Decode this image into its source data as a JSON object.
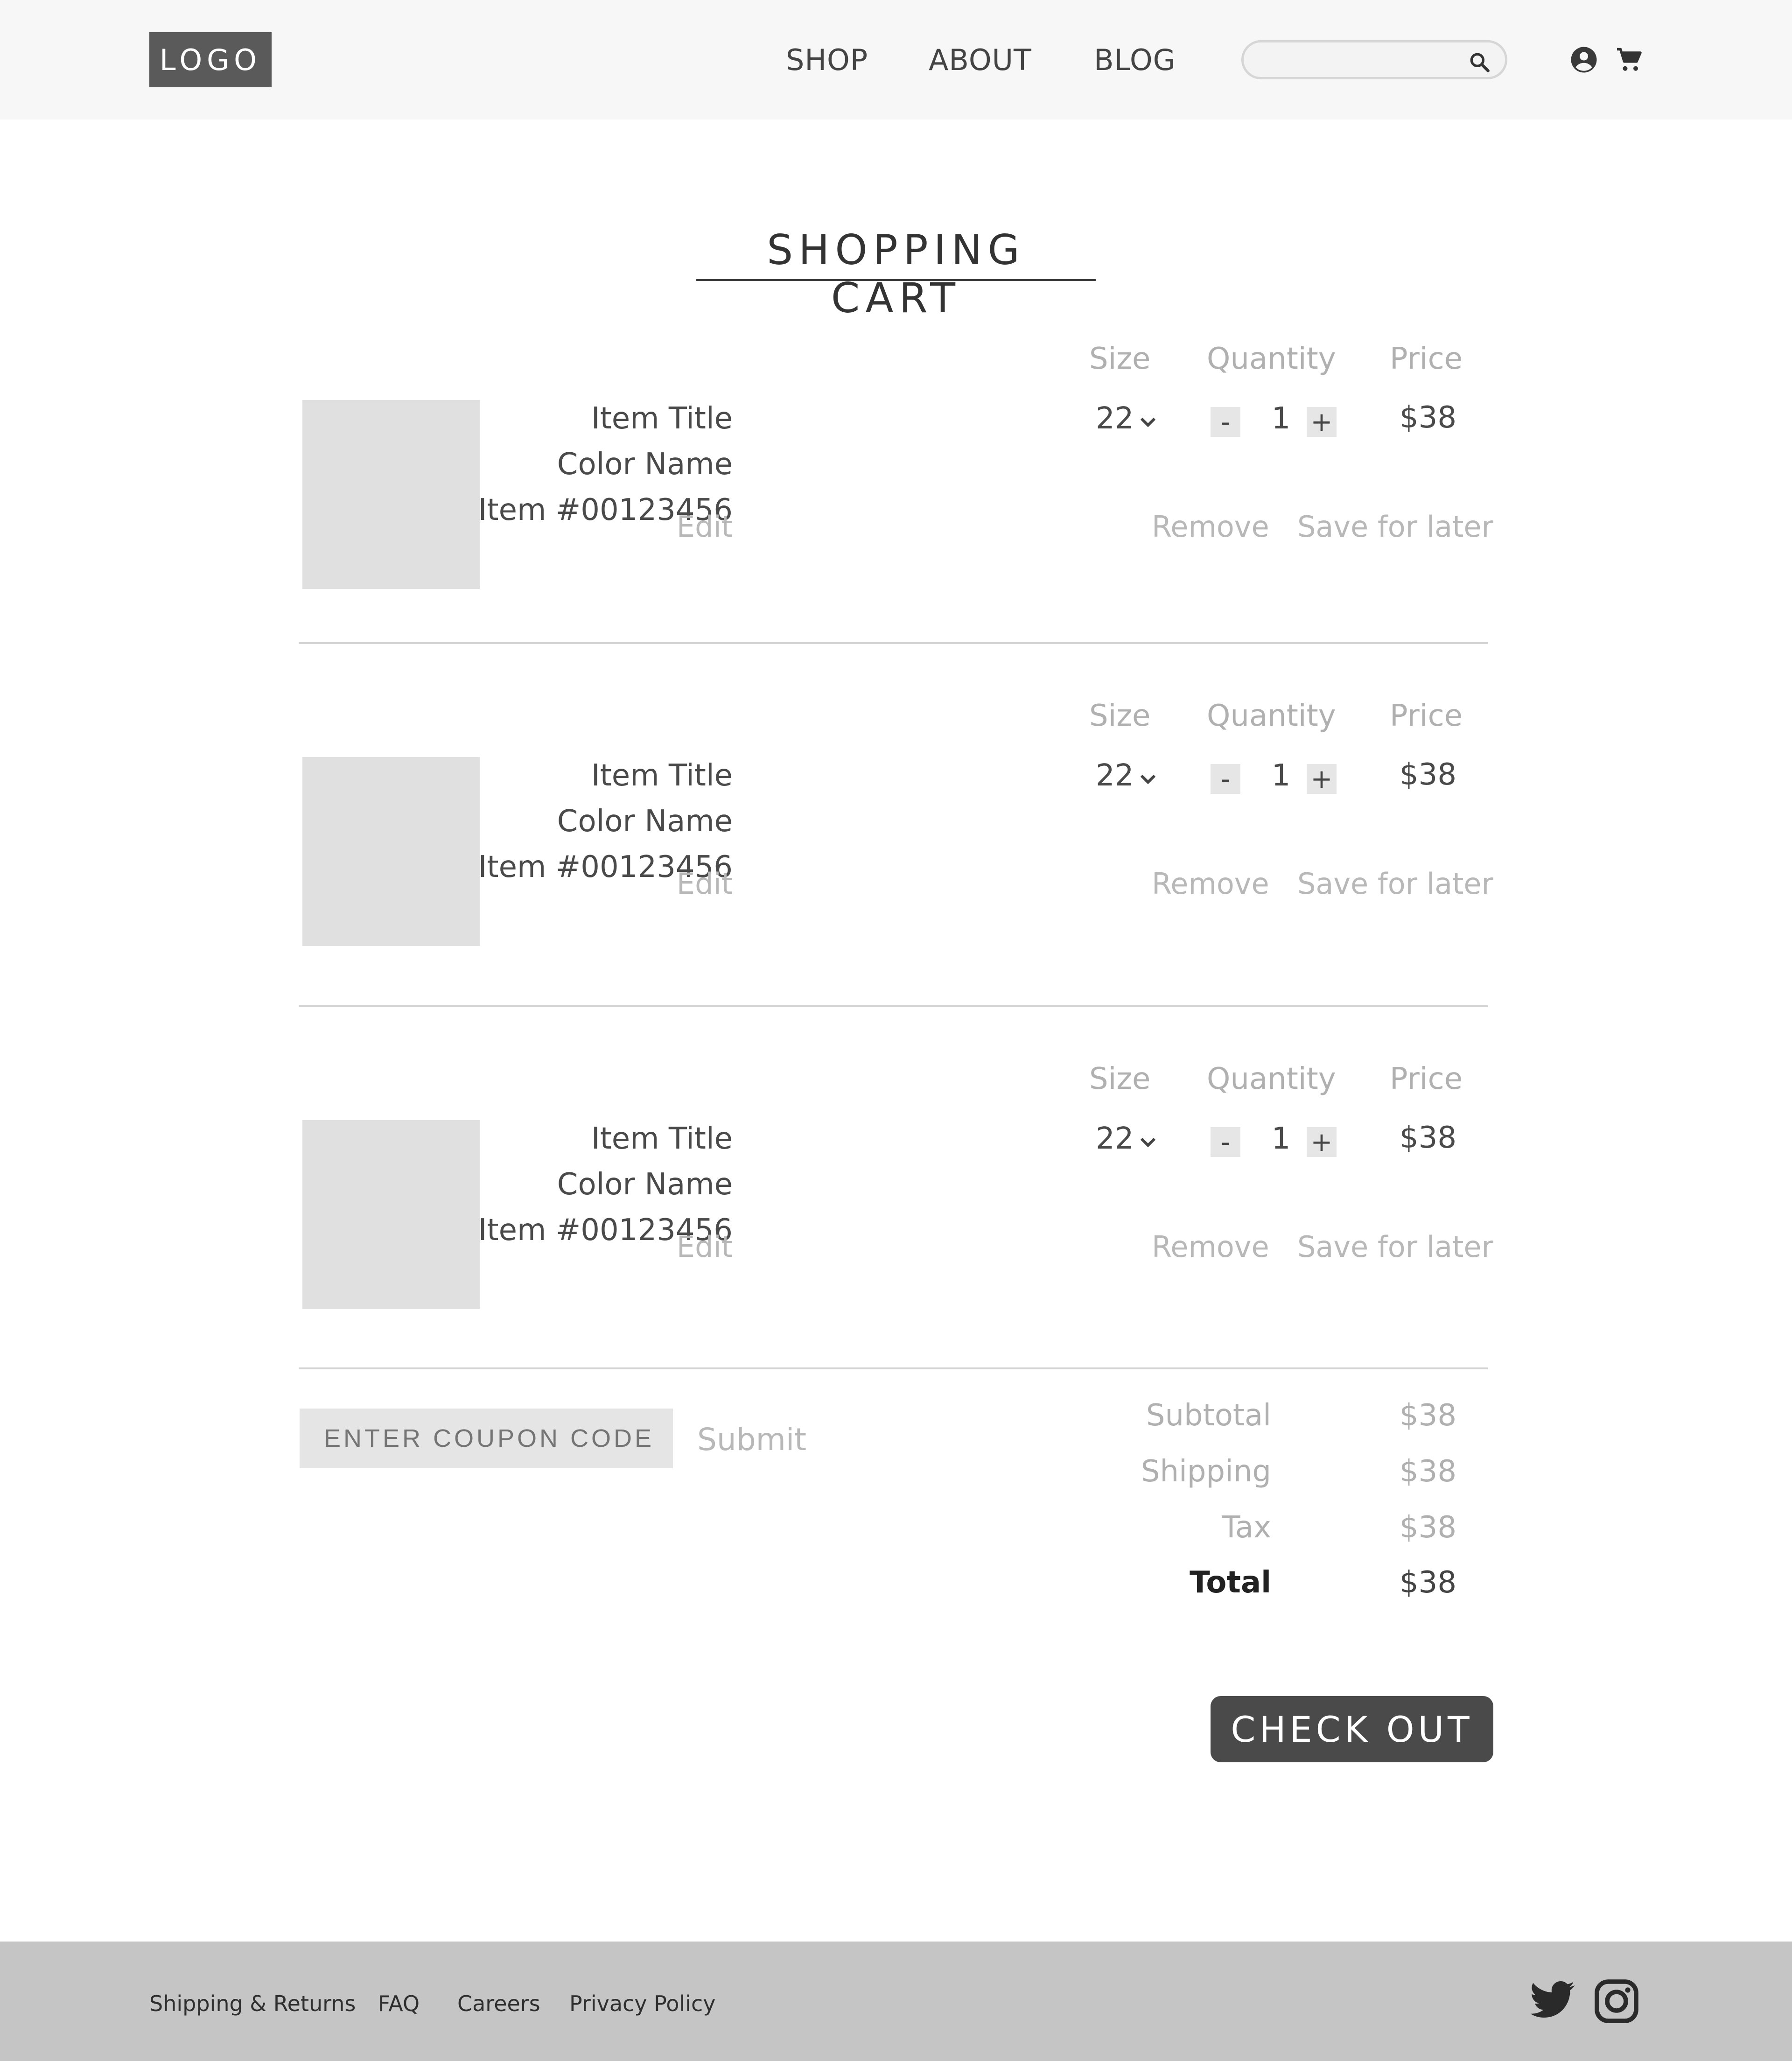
{
  "header": {
    "logo": "LOGO",
    "nav": [
      "SHOP",
      "ABOUT",
      "BLOG"
    ],
    "search": {
      "value": "",
      "placeholder": ""
    }
  },
  "page": {
    "title": "SHOPPING CART"
  },
  "columns": {
    "size": "Size",
    "quantity": "Quantity",
    "price": "Price"
  },
  "items": [
    {
      "title": "Item Title",
      "color": "Color Name",
      "number": "Item #00123456",
      "size": "22",
      "quantity": "1",
      "price": "$38"
    },
    {
      "title": "Item Title",
      "color": "Color Name",
      "number": "Item #00123456",
      "size": "22",
      "quantity": "1",
      "price": "$38"
    },
    {
      "title": "Item Title",
      "color": "Color Name",
      "number": "Item #00123456",
      "size": "22",
      "quantity": "1",
      "price": "$38"
    }
  ],
  "item_actions": {
    "edit": "Edit",
    "remove": "Remove",
    "save": "Save for later",
    "minus": "-",
    "plus": "+"
  },
  "coupon": {
    "placeholder": "ENTER COUPON CODE",
    "submit": "Submit"
  },
  "summary": {
    "subtotal_label": "Subtotal",
    "subtotal": "$38",
    "shipping_label": "Shipping",
    "shipping": "$38",
    "tax_label": "Tax",
    "tax": "$38",
    "total_label": "Total",
    "total": "$38"
  },
  "checkout": "CHECK OUT",
  "footer": {
    "links": [
      "Shipping & Returns",
      "FAQ",
      "Careers",
      "Privacy Policy"
    ],
    "social": [
      "twitter-icon",
      "instagram-icon"
    ]
  },
  "colors": {
    "header_bg": "#f7f7f7",
    "footer_bg": "#c5c5c5",
    "button_dark": "#4a4a4a",
    "placeholder_gray": "#e0e0e0"
  }
}
